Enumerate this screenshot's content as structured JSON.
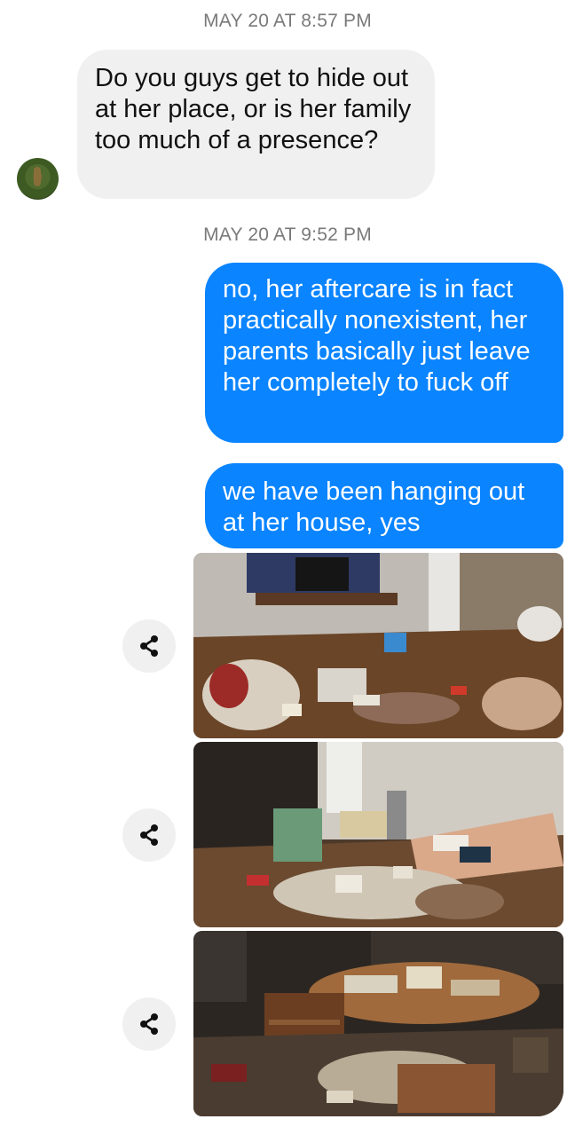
{
  "timestamps": [
    "MAY 20 AT 8:57 PM",
    "MAY 20 AT 9:52 PM"
  ],
  "messages": {
    "received_1": "Do you guys get to hide out at her place, or is her family too much of a presence?",
    "sent_1": "no, her aftercare is in fact practically nonexistent, her parents basically just leave her completely to fuck off",
    "sent_2": "we have been hanging out at her house, yes"
  },
  "photos": [
    {
      "icon": "share-icon"
    },
    {
      "icon": "share-icon"
    },
    {
      "icon": "share-icon"
    }
  ],
  "colors": {
    "sent_bubble": "#0a84ff",
    "received_bubble": "#f0f0f0",
    "timestamp": "#7a7a7a"
  }
}
